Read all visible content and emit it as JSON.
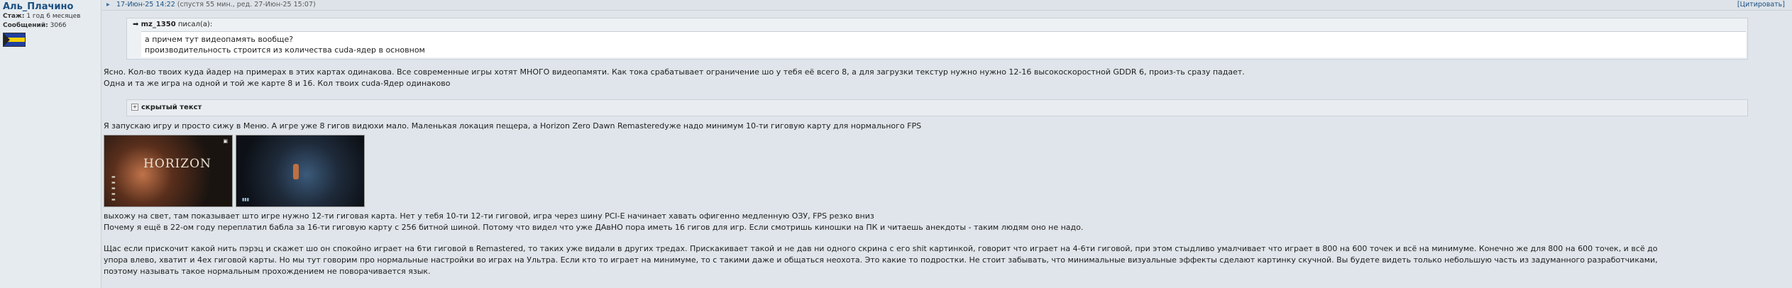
{
  "author": {
    "name": "Аль_Плачино",
    "tenure_label": "Стаж:",
    "tenure_value": "1 год 6 месяцев",
    "messages_label": "Сообщений:",
    "messages_value": "3066"
  },
  "post": {
    "date": "17-Июн-25 14:22",
    "edit_info": "(спустя 55 мин., ред. 27-Июн-25 15:07)",
    "quote_button": "[Цитировать]"
  },
  "quote": {
    "user": "mz_1350",
    "said": "писал(а):",
    "lines": [
      "а причем тут видеопамять вообще?",
      "производительность строится из количества cuda-ядер в основном"
    ]
  },
  "paragraphs": {
    "p1": "Ясно. Кол-во твоих куда йадер на примерах в этих картах одинакова. Все современные игры хотят МНОГО видеопамяти. Как тока срабатывает ограничение шо у тебя её всего 8, а для загрузки текстур нужно нужно 12-16 высокоскоростной GDDR 6, произ-ть сразу падает.",
    "p2": "Одна и та же игра на одной и той же карте 8 и 16. Кол твоих cuda-Ядер одинаково",
    "spoiler": "скрытый текст",
    "p3": "Я запускаю игру и просто сижу в Меню. А игре уже 8 гигов видюхи мало. Маленькая локация пещера, а Horizon Zero Dawn Remasteredуже надо минимум 10-ти гиговую карту для нормального FPS",
    "p4": "выхожу на свет, там показывает што игре нужно 12-ти гиговая карта. Нет у тебя 10-ти 12-ти гиговой, игра через шину PCI-E начинает хавать офигенно медленную ОЗУ, FPS резко вниз",
    "p5": "Почему я ещё в 22-ом году переплатил бабла за 16-ти гиговую карту с 256 битной шиной. Потому что видел что уже ДАвНО пора иметь 16 гигов для игр. Если смотришь киношки на ПК и читаешь анекдоты - таким людям оно не надо.",
    "p6a": "Щас если приcкочит какой нить пэрэц и скажет шо он спокойно играет на 6ти гиговой в Remastered, то таких уже видали в других тредах. Прискакивает такой и не дав ни одного скрина с его shit картинкой, говорит что играет на 4-6ти гиговой, при этом стыдливо умалчивает что играет в 800 на 600 точек и всё на минимуме. Конечно же для 800 на 600 точек, и всё до",
    "p6b": "упора влево, хватит и 4ех гиговой карты. Но мы тут говорим про нормальные настройки во играх на Ультра. Если кто то играет на минимуме, то с такими даже и общаться неохота. Это какие то подростки. Не стоит забывать, что минимальные визуальные эффекты сделают картинку скучной. Вы будете видеть только небольшую часть из задуманного разработчиками,",
    "p6c": "поэтому называть такое нормальным прохождением не поворачивается язык."
  },
  "screenshots": {
    "shot1_title": "HORIZON"
  }
}
